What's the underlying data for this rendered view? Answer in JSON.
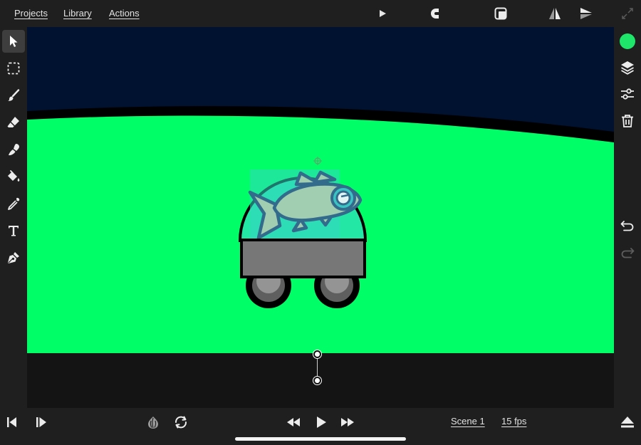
{
  "menu": {
    "projects": "Projects",
    "library": "Library",
    "actions": "Actions"
  },
  "top_icons": [
    "play-icon",
    "magnet-icon",
    "onion-frame-icon",
    "flip-horizontal-icon",
    "flip-vertical-icon",
    "fullscreen-icon"
  ],
  "tools": [
    "select-icon",
    "marquee-icon",
    "brush-icon",
    "eraser-icon",
    "smudge-icon",
    "fill-icon",
    "eyedropper-icon",
    "text-icon",
    "pen-icon"
  ],
  "active_tool": "select",
  "right_tools": [
    "color-swatch",
    "layers-icon",
    "adjust-icon",
    "trash-icon",
    "undo-icon",
    "redo-icon"
  ],
  "colors": {
    "current_color": "#1ee66a",
    "sky": "#001230",
    "ground": "#00ff66",
    "pasteboard": "#141414",
    "chrome": "#1f1f1f"
  },
  "timeline": {
    "scene": "Scene 1",
    "fps": "15 fps"
  }
}
